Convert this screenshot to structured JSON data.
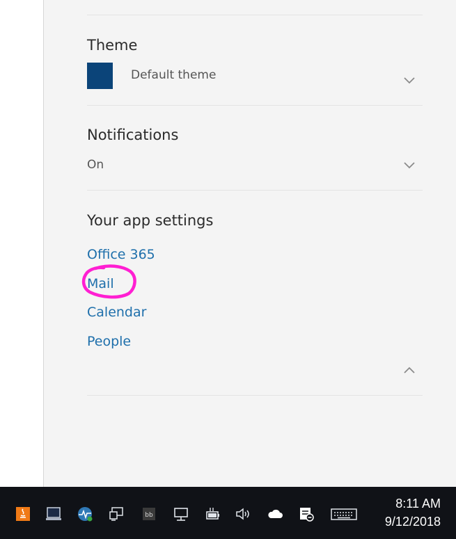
{
  "theme": {
    "title": "Theme",
    "value": "Default theme",
    "swatch_color": "#0b4479",
    "expander_icon": "chevron-down-icon"
  },
  "notifications": {
    "title": "Notifications",
    "value": "On",
    "expander_icon": "chevron-down-icon"
  },
  "app_settings": {
    "title": "Your app settings",
    "links": [
      "Office 365",
      "Mail",
      "Calendar",
      "People"
    ],
    "collapse_icon": "chevron-up-icon",
    "annotation_color": "#ff1fd2"
  },
  "taskbar": {
    "tray_icons": [
      "java-update-icon",
      "laptop-icon",
      "network-monitor-icon",
      "remote-desktop-icon",
      "app-tray-icon",
      "network-icon",
      "battery-power-icon",
      "volume-icon",
      "onedrive-cloud-icon",
      "action-center-icon",
      "touch-keyboard-icon"
    ],
    "time": "8:11 AM",
    "date": "9/12/2018"
  }
}
